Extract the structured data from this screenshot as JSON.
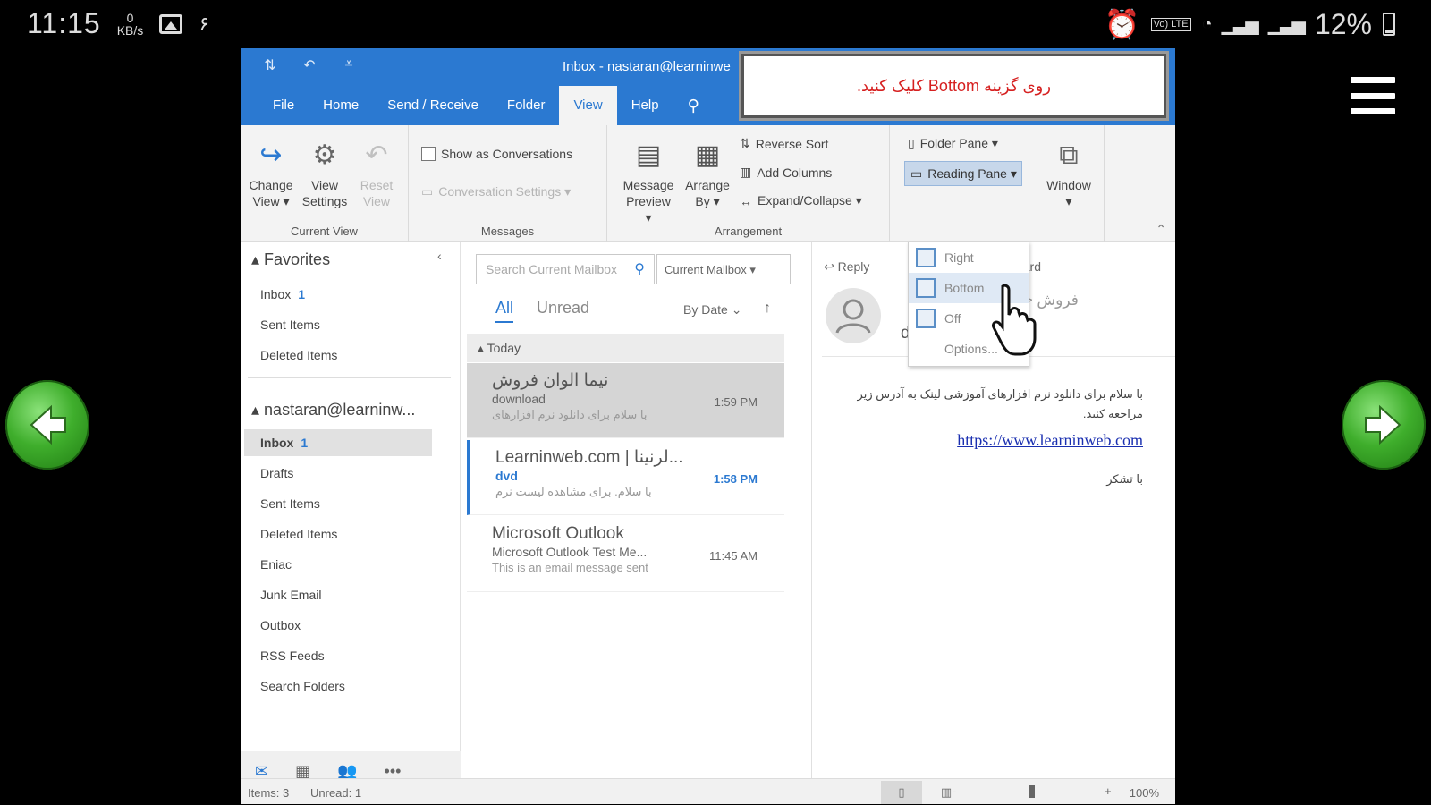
{
  "phone_status": {
    "time": "11:15",
    "net_speed_value": "0",
    "net_speed_unit": "KB/s",
    "extra_digit": "۶",
    "battery": "12%",
    "lte_label": "Vo) LTE"
  },
  "window": {
    "title": "Inbox - nastaran@learninwe",
    "tabs": [
      "File",
      "Home",
      "Send / Receive",
      "Folder",
      "View",
      "Help"
    ],
    "active_tab": "View"
  },
  "instruction": {
    "text": "روی گزینه Bottom کلیک کنید."
  },
  "ribbon": {
    "current_view": {
      "label": "Current View",
      "change_view": [
        "Change",
        "View ▾"
      ],
      "view_settings": [
        "View",
        "Settings"
      ],
      "reset_view": [
        "Reset",
        "View"
      ]
    },
    "messages": {
      "label": "Messages",
      "show_as_conversations": "Show as Conversations",
      "conversation_settings": "Conversation Settings ▾"
    },
    "arrangement": {
      "label": "Arrangement",
      "message_preview": [
        "Message",
        "Preview ▾"
      ],
      "arrange_by": [
        "Arrange",
        "By ▾"
      ],
      "reverse_sort": "Reverse Sort",
      "add_columns": "Add Columns",
      "expand_collapse": "Expand/Collapse ▾"
    },
    "layout": {
      "folder_pane": "Folder Pane ▾",
      "reading_pane": "Reading Pane ▾"
    },
    "window": [
      "Window",
      "▾"
    ]
  },
  "reading_pane_menu": {
    "items": [
      "Right",
      "Bottom",
      "Off"
    ],
    "options": "Options..."
  },
  "folder_pane": {
    "favorites_header": "Favorites",
    "favorites": [
      {
        "name": "Inbox",
        "count": "1"
      },
      {
        "name": "Sent Items",
        "count": ""
      },
      {
        "name": "Deleted Items",
        "count": ""
      }
    ],
    "account_header": "nastaran@learninw...",
    "folders": [
      {
        "name": "Inbox",
        "count": "1"
      },
      {
        "name": "Drafts",
        "count": ""
      },
      {
        "name": "Sent Items",
        "count": ""
      },
      {
        "name": "Deleted Items",
        "count": ""
      },
      {
        "name": "Eniac",
        "count": ""
      },
      {
        "name": "Junk Email",
        "count": ""
      },
      {
        "name": "Outbox",
        "count": ""
      },
      {
        "name": "RSS Feeds",
        "count": ""
      },
      {
        "name": "Search Folders",
        "count": ""
      }
    ]
  },
  "message_list": {
    "search_placeholder": "Search Current Mailbox",
    "scope": "Current Mailbox",
    "filter_all": "All",
    "filter_unread": "Unread",
    "sort_by": "By Date",
    "group_today": "Today",
    "messages": [
      {
        "sender": "نیما الوان فروش",
        "subject": "download",
        "preview": "با سلام برای دانلود نرم افزارهای",
        "time": "1:59 PM"
      },
      {
        "sender": "Learninweb.com | لرنینا...",
        "subject": "dvd",
        "preview": "با سلام. برای مشاهده لیست نرم",
        "time": "1:58 PM"
      },
      {
        "sender": "Microsoft Outlook",
        "subject": "Microsoft Outlook Test Me...",
        "preview": "This is an email message sent",
        "time": "11:45 AM"
      }
    ]
  },
  "reading_pane": {
    "reply": "Reply",
    "forward": "rward",
    "from": "eb.com> فروش",
    "subject": "download",
    "body_line1": "با سلام برای دانلود نرم افزارهای آموزشی لینک به آدرس زیر مراجعه کنید.",
    "link": "https://www.learninweb.com",
    "body_line2": "با تشکر"
  },
  "status_bar": {
    "items": "Items: 3",
    "unread": "Unread: 1",
    "zoom": "100%"
  }
}
